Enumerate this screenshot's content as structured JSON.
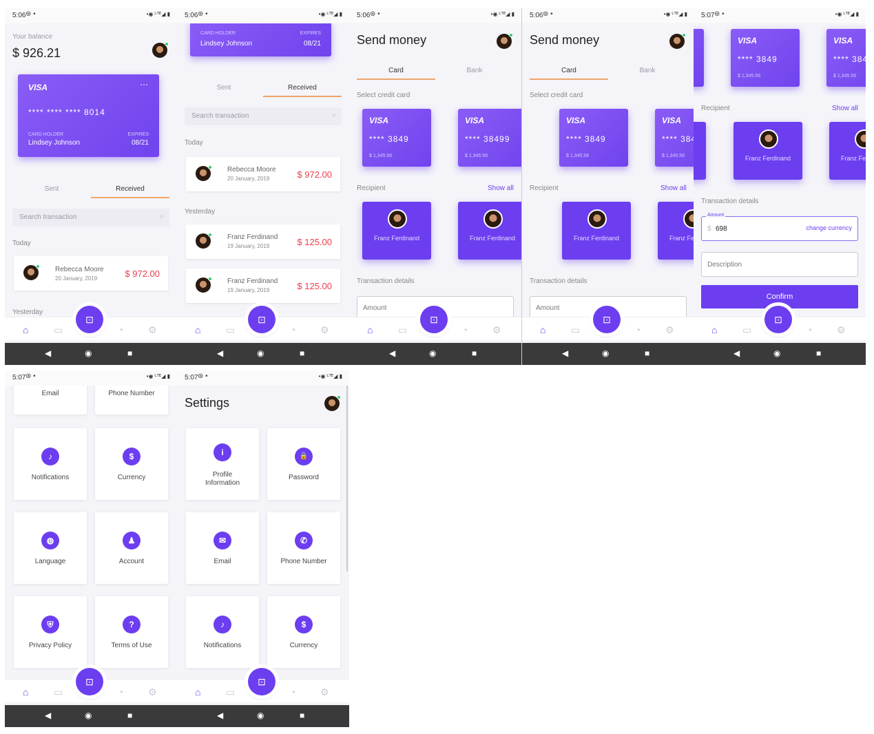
{
  "status": {
    "time_a": "5:06",
    "time_b": "5:07",
    "icons": "•◉ ᴸᵀᴱ◢ ▮",
    "gear": "⊛ •"
  },
  "home": {
    "balance_label": "Your balance",
    "balance": "$ 926.21"
  },
  "card": {
    "brand": "VISA",
    "dots": "⋯",
    "number": "**** **** **** 8014",
    "holder_label": "CARD HOLDER",
    "holder": "Lindsey Johnson",
    "expires_label": "EXPIRES",
    "expires": "08/21"
  },
  "tabs": {
    "sent": "Sent",
    "received": "Received"
  },
  "search": {
    "placeholder": "Search transaction",
    "icon": "⌕"
  },
  "sections": {
    "today": "Today",
    "yesterday": "Yesterday"
  },
  "transactions": [
    {
      "name": "Rebecca Moore",
      "date": "20 January, 2019",
      "amount": "$ 972.00"
    },
    {
      "name": "Franz Ferdinand",
      "date": "19 January, 2019",
      "amount": "$ 125.00"
    },
    {
      "name": "Franz Ferdinand",
      "date": "19 January, 2019",
      "amount": "$ 125.00"
    }
  ],
  "send": {
    "title": "Send money",
    "tab_card": "Card",
    "tab_bank": "Bank",
    "select_label": "Select credit card",
    "card_num": "**** 3849",
    "card_num_alt": "**** 38499",
    "card_balance": "$ 1,345.56",
    "visa": "VISA",
    "recipient_label": "Recipient",
    "show_all": "Show all",
    "recipient_name": "Franz Ferdinand",
    "details_label": "Transaction details",
    "amount_label": "Amount",
    "amount_value": "698",
    "change_currency": "change currency",
    "currency_symbol": "$",
    "description": "Description",
    "confirm": "Confirm"
  },
  "settings": {
    "title": "Settings",
    "tiles_top": [
      "Email",
      "Phone Number"
    ],
    "tiles_a": [
      {
        "label": "Notifications",
        "icon": "bell-icon",
        "glyph": "♪"
      },
      {
        "label": "Currency",
        "icon": "dollar-icon",
        "glyph": "$"
      },
      {
        "label": "Language",
        "icon": "globe-icon",
        "glyph": "◍"
      },
      {
        "label": "Account",
        "icon": "person-icon",
        "glyph": "♟"
      },
      {
        "label": "Privacy Policy",
        "icon": "shield-icon",
        "glyph": "⛨"
      },
      {
        "label": "Terms of Use",
        "icon": "question-icon",
        "glyph": "?"
      }
    ],
    "tiles_b": [
      {
        "label": "Profile Information",
        "icon": "info-icon",
        "glyph": "i"
      },
      {
        "label": "Password",
        "icon": "lock-icon",
        "glyph": "🔒"
      },
      {
        "label": "Email",
        "icon": "mail-icon",
        "glyph": "✉"
      },
      {
        "label": "Phone Number",
        "icon": "phone-icon",
        "glyph": "✆"
      },
      {
        "label": "Notifications",
        "icon": "bell-icon",
        "glyph": "♪"
      },
      {
        "label": "Currency",
        "icon": "dollar-icon",
        "glyph": "$"
      }
    ]
  },
  "nav": {
    "home": "⌂",
    "wallet": "▭",
    "fab": "⊡",
    "chart": "◔",
    "settings": "⚙"
  },
  "android": {
    "back": "◀",
    "home": "◉",
    "recent": "■"
  },
  "colors": {
    "accent": "#6c3ef0",
    "amount": "#ef3b4b",
    "underline": "#f1a46a"
  }
}
